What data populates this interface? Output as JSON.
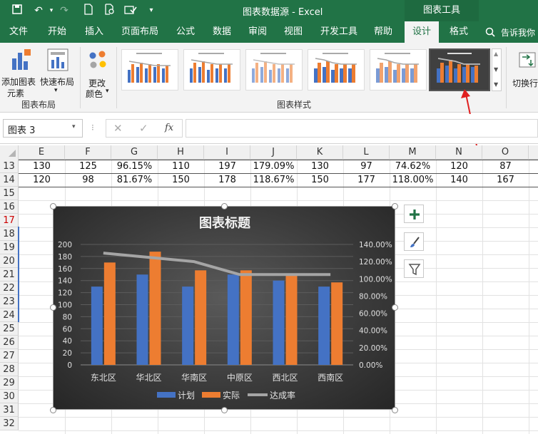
{
  "window": {
    "title": "图表数据源 - Excel",
    "context_tab": "图表工具"
  },
  "ribbon_tabs": [
    "文件",
    "开始",
    "插入",
    "页面布局",
    "公式",
    "数据",
    "审阅",
    "视图",
    "开发工具",
    "帮助",
    "设计",
    "格式"
  ],
  "active_tab": "设计",
  "tell_me": "告诉我你",
  "ribbon": {
    "add_element": "添加图表",
    "add_element2": "元素",
    "quick_layout": "快速布局",
    "group_layout": "图表布局",
    "change_colors": "更改",
    "change_colors2": "颜色",
    "group_styles": "图表样式",
    "switch_rowcol": "切换行"
  },
  "formula_bar": {
    "name_box": "图表 3",
    "fx": "fx"
  },
  "columns": [
    "E",
    "F",
    "G",
    "H",
    "I",
    "J",
    "K",
    "L",
    "M",
    "N",
    "O"
  ],
  "rows": {
    "r13": {
      "num": "13",
      "cells": [
        "130",
        "125",
        "96.15%",
        "110",
        "197",
        "179.09%",
        "130",
        "97",
        "74.62%",
        "120",
        "87"
      ]
    },
    "r14": {
      "num": "14",
      "cells": [
        "120",
        "98",
        "81.67%",
        "150",
        "178",
        "118.67%",
        "150",
        "177",
        "118.00%",
        "140",
        "167"
      ]
    }
  },
  "row_numbers": [
    "15",
    "16",
    "17",
    "18",
    "19",
    "20",
    "21",
    "22",
    "23",
    "24",
    "25",
    "26",
    "27",
    "28",
    "29",
    "30",
    "31",
    "32"
  ],
  "chart_data": {
    "type": "bar",
    "title": "图表标题",
    "categories": [
      "东北区",
      "华北区",
      "华南区",
      "中原区",
      "西北区",
      "西南区"
    ],
    "series": [
      {
        "name": "计划",
        "type": "bar",
        "values": [
          130,
          150,
          130,
          150,
          140,
          130
        ]
      },
      {
        "name": "实际",
        "type": "bar",
        "values": [
          170,
          188,
          157,
          157,
          150,
          137
        ]
      },
      {
        "name": "达成率",
        "type": "line",
        "axis": "secondary",
        "values": [
          1.3,
          1.25,
          1.2,
          1.05,
          1.05,
          1.05
        ]
      }
    ],
    "ylim": [
      0,
      200
    ],
    "y_ticks": [
      "200",
      "180",
      "160",
      "140",
      "120",
      "100",
      "80",
      "60",
      "40",
      "20",
      "0"
    ],
    "y2lim": [
      0,
      1.4
    ],
    "y2_ticks": [
      "140.00%",
      "120.00%",
      "100.00%",
      "80.00%",
      "60.00%",
      "40.00%",
      "20.00%",
      "0.00%"
    ],
    "legend": "bottom",
    "colors": {
      "plan": "#4472c4",
      "actual": "#ed7d31",
      "rate": "#a5a5a5"
    }
  }
}
